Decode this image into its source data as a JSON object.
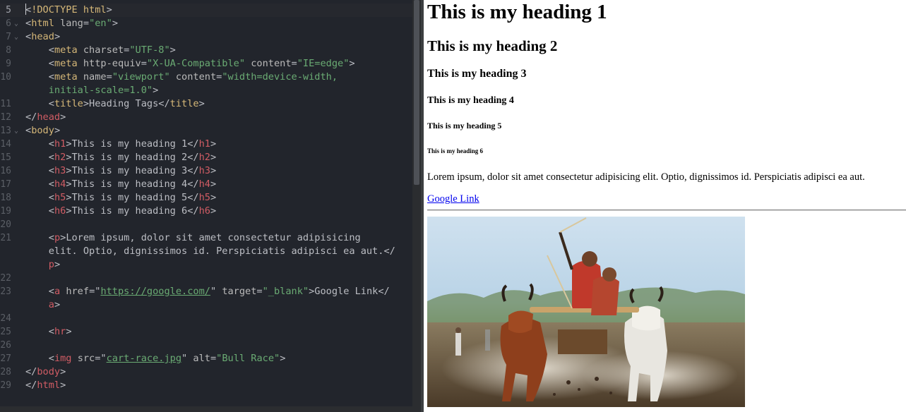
{
  "editor": {
    "lines": [
      {
        "num": "5",
        "fold": "",
        "active": true
      },
      {
        "num": "6",
        "fold": "⌄"
      },
      {
        "num": "7",
        "fold": "⌄"
      },
      {
        "num": "8",
        "fold": ""
      },
      {
        "num": "9",
        "fold": ""
      },
      {
        "num": "10",
        "fold": ""
      },
      {
        "num": "",
        "fold": ""
      },
      {
        "num": "11",
        "fold": ""
      },
      {
        "num": "12",
        "fold": ""
      },
      {
        "num": "13",
        "fold": "⌄"
      },
      {
        "num": "14",
        "fold": ""
      },
      {
        "num": "15",
        "fold": ""
      },
      {
        "num": "16",
        "fold": ""
      },
      {
        "num": "17",
        "fold": ""
      },
      {
        "num": "18",
        "fold": ""
      },
      {
        "num": "19",
        "fold": ""
      },
      {
        "num": "20",
        "fold": ""
      },
      {
        "num": "21",
        "fold": ""
      },
      {
        "num": "",
        "fold": ""
      },
      {
        "num": "",
        "fold": ""
      },
      {
        "num": "22",
        "fold": ""
      },
      {
        "num": "23",
        "fold": ""
      },
      {
        "num": "",
        "fold": ""
      },
      {
        "num": "24",
        "fold": ""
      },
      {
        "num": "25",
        "fold": ""
      },
      {
        "num": "26",
        "fold": ""
      },
      {
        "num": "27",
        "fold": ""
      },
      {
        "num": "28",
        "fold": ""
      },
      {
        "num": "29",
        "fold": ""
      }
    ],
    "code": {
      "doctype": "!DOCTYPE",
      "doctype_rest": " html",
      "html_tag": "html",
      "lang_attr": "lang",
      "lang_val": "\"en\"",
      "head_tag": "head",
      "meta_tag": "meta",
      "charset_attr": "charset",
      "charset_val": "\"UTF-8\"",
      "http_equiv_attr": "http-equiv",
      "http_equiv_val": "\"X-UA-Compatible\"",
      "content_attr": "content",
      "ie_edge_val": "\"IE=edge\"",
      "name_attr": "name",
      "viewport_val": "\"viewport\"",
      "viewport_content_1": "\"width=device-width,",
      "viewport_content_2": "initial-scale=1.0\"",
      "title_tag": "title",
      "title_text": "Heading Tags",
      "body_tag": "body",
      "h1_tag": "h1",
      "h1_text": "This is my heading 1",
      "h2_tag": "h2",
      "h2_text": "This is my heading 2",
      "h3_tag": "h3",
      "h3_text": "This is my heading 3",
      "h4_tag": "h4",
      "h4_text": "This is my heading 4",
      "h5_tag": "h5",
      "h5_text": "This is my heading 5",
      "h6_tag": "h6",
      "h6_text": "This is my heading 6",
      "p_tag": "p",
      "p_text_1": "Lorem ipsum, dolor sit amet consectetur adipisicing",
      "p_text_2": "elit. Optio, dignissimos id. Perspiciatis adipisci ea aut.",
      "a_tag": "a",
      "href_attr": "href",
      "href_val": "https://google.com/",
      "target_attr": "target",
      "target_val": "\"_blank\"",
      "a_text": "Google Link",
      "hr_tag": "hr",
      "img_tag": "img",
      "src_attr": "src",
      "src_val": "cart-race.jpg",
      "alt_attr": "alt",
      "alt_val": "\"Bull Race\""
    }
  },
  "preview": {
    "h1": "This is my heading 1",
    "h2": "This is my heading 2",
    "h3": "This is my heading 3",
    "h4": "This is my heading 4",
    "h5": "This is my heading 5",
    "h6": "This is my heading 6",
    "paragraph": "Lorem ipsum, dolor sit amet consectetur adipisicing elit. Optio, dignissimos id. Perspiciatis adipisci ea aut.",
    "link": "Google Link",
    "image_alt": "Bull Race"
  },
  "colors": {
    "editor_bg": "#22252c",
    "tag": "#d5b778",
    "value": "#6aab73",
    "link": "#0000ee"
  }
}
